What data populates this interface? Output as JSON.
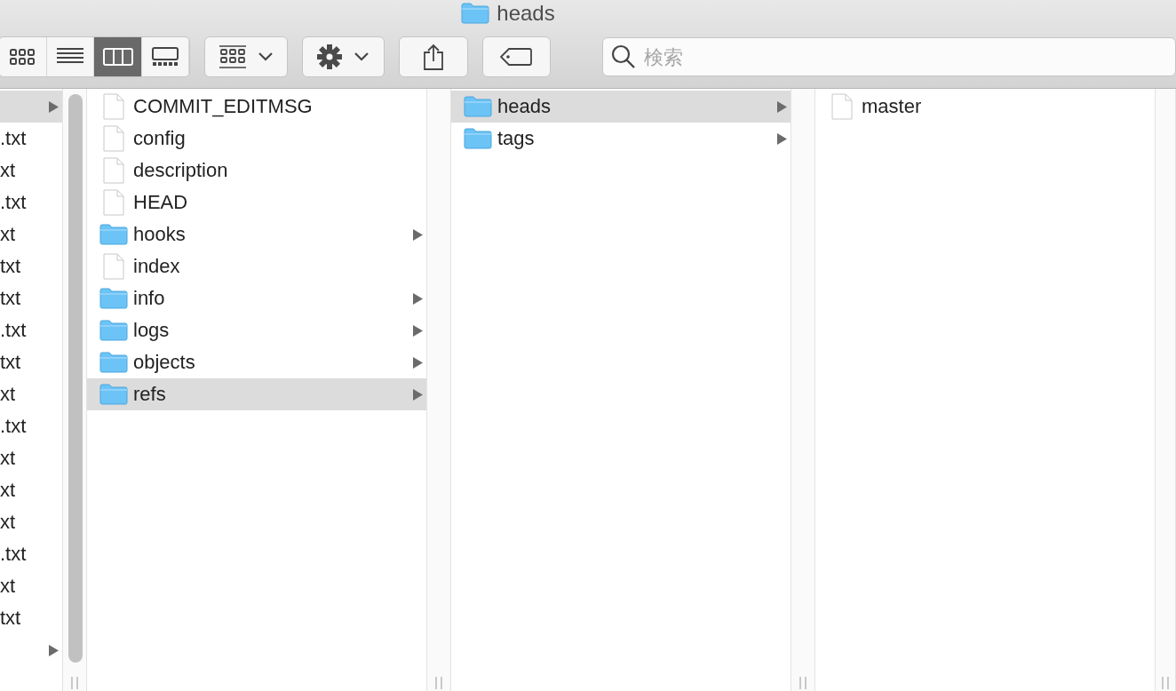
{
  "window": {
    "title": "heads"
  },
  "toolbar": {
    "view_buttons": [
      {
        "kind": "icons",
        "selected": false
      },
      {
        "kind": "list",
        "selected": false
      },
      {
        "kind": "columns",
        "selected": true
      },
      {
        "kind": "gallery",
        "selected": false
      }
    ]
  },
  "search": {
    "placeholder": "検索"
  },
  "columns": [
    {
      "items": [
        {
          "kind": "folder",
          "selected": true
        },
        {
          "name": ".txt",
          "kind": "file",
          "selected": false
        },
        {
          "name": "xt",
          "kind": "file",
          "selected": false
        },
        {
          "name": ".txt",
          "kind": "file",
          "selected": false
        },
        {
          "name": "xt",
          "kind": "file",
          "selected": false
        },
        {
          "name": "txt",
          "kind": "file",
          "selected": false
        },
        {
          "name": "txt",
          "kind": "file",
          "selected": false
        },
        {
          "name": ".txt",
          "kind": "file",
          "selected": false
        },
        {
          "name": "txt",
          "kind": "file",
          "selected": false
        },
        {
          "name": "xt",
          "kind": "file",
          "selected": false
        },
        {
          "name": ".txt",
          "kind": "file",
          "selected": false
        },
        {
          "name": "xt",
          "kind": "file",
          "selected": false
        },
        {
          "name": "xt",
          "kind": "file",
          "selected": false
        },
        {
          "name": "xt",
          "kind": "file",
          "selected": false
        },
        {
          "name": ".txt",
          "kind": "file",
          "selected": false
        },
        {
          "name": "xt",
          "kind": "file",
          "selected": false
        },
        {
          "name": "txt",
          "kind": "file",
          "selected": false
        },
        {
          "kind": "folder",
          "selected": false
        }
      ]
    },
    {
      "items": [
        {
          "name": "COMMIT_EDITMSG",
          "kind": "file",
          "selected": false
        },
        {
          "name": "config",
          "kind": "file",
          "selected": false
        },
        {
          "name": "description",
          "kind": "file",
          "selected": false
        },
        {
          "name": "HEAD",
          "kind": "file",
          "selected": false
        },
        {
          "name": "hooks",
          "kind": "folder",
          "selected": false
        },
        {
          "name": "index",
          "kind": "file",
          "selected": false
        },
        {
          "name": "info",
          "kind": "folder",
          "selected": false
        },
        {
          "name": "logs",
          "kind": "folder",
          "selected": false
        },
        {
          "name": "objects",
          "kind": "folder",
          "selected": false
        },
        {
          "name": "refs",
          "kind": "folder",
          "selected": true
        }
      ]
    },
    {
      "items": [
        {
          "name": "heads",
          "kind": "folder",
          "selected": true
        },
        {
          "name": "tags",
          "kind": "folder",
          "selected": false
        }
      ]
    },
    {
      "items": [
        {
          "name": "master",
          "kind": "file",
          "selected": false
        }
      ]
    }
  ]
}
